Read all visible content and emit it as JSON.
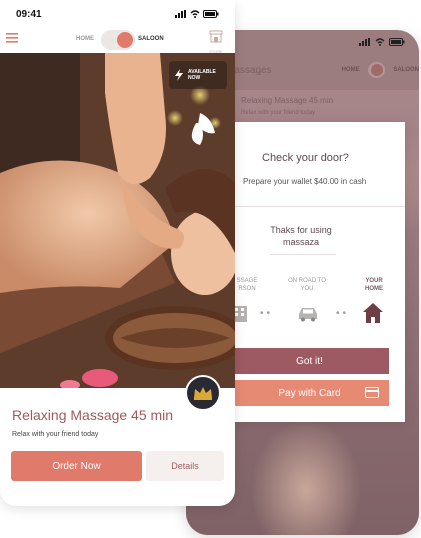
{
  "back_screen": {
    "title": "Massages",
    "home_label": "HOME",
    "saloon_label": "SALOON",
    "item_title": "Relaxing Massage 45 min",
    "item_sub": "Relax with your friend today"
  },
  "modal": {
    "title": "Check your door?",
    "subtitle": "Prepare your wallet $40.00 in cash",
    "thanks": "Thaks for using massaza",
    "steps": [
      {
        "label": "MASSAGE PERSON",
        "shown": "SSAGE RSON",
        "icon": "building-icon",
        "active": false
      },
      {
        "label": "ON ROAD TO YOU",
        "icon": "car-icon",
        "active": false
      },
      {
        "label": "YOUR HOME",
        "icon": "house-icon",
        "active": true
      }
    ],
    "got_it_label": "Got it!",
    "pay_card_label": "Pay with Card"
  },
  "status": {
    "time": "09:41"
  },
  "topnav": {
    "home_label": "HOME",
    "saloon_label": "SALOON",
    "mode": "saloon",
    "store_label": "STORE"
  },
  "hero": {
    "availability": "AVAILABLE NOW",
    "badge_icon": "crown-icon"
  },
  "card": {
    "title": "Relaxing Massage 45 min",
    "subtitle": "Relax with your friend today",
    "order_label": "Order Now",
    "details_label": "Details"
  },
  "colors": {
    "accent": "#e07a6a",
    "wine": "#9e5a63",
    "title": "#a25a5a"
  }
}
